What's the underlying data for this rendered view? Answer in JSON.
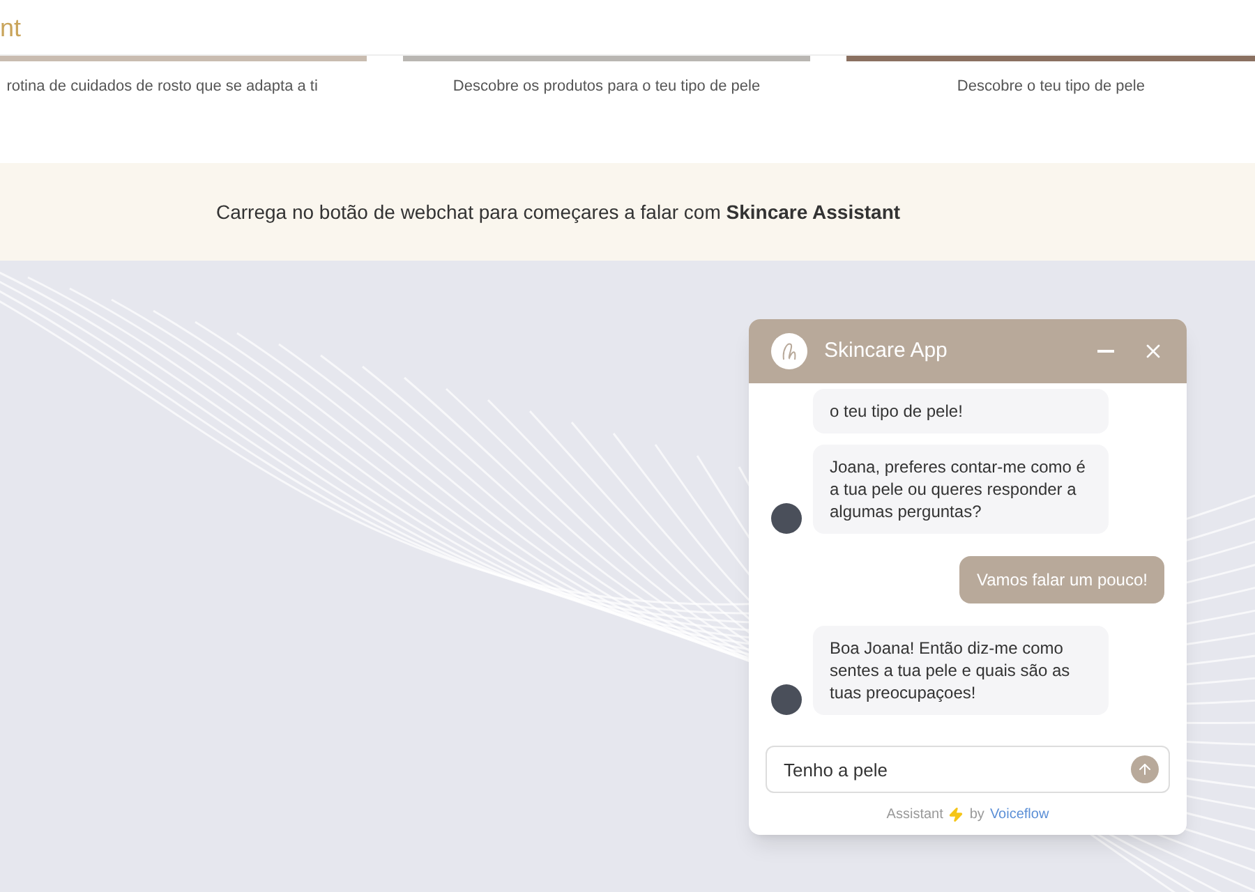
{
  "header": {
    "brand": "nt"
  },
  "cards": [
    {
      "caption": "rotina de cuidados de rosto que se adapta a ti"
    },
    {
      "caption": "Descobre os produtos para o teu tipo de pele"
    },
    {
      "caption": "Descobre o teu tipo de pele"
    }
  ],
  "banner": {
    "text": "Carrega no botão de webchat para começares a falar com **Skincare Assistant**"
  },
  "chat": {
    "title": "Skincare App",
    "messages": [
      {
        "kind": "bot",
        "text": "o teu tipo de pele!",
        "avatar": false
      },
      {
        "kind": "bot",
        "text": "Joana, preferes contar-me como é a tua pele ou queres responder a algumas perguntas?",
        "avatar": true
      },
      {
        "kind": "user",
        "text": "Vamos falar um pouco!"
      },
      {
        "kind": "bot",
        "text": "Boa Joana! Então diz-me como sentes a tua pele e quais são as tuas preocupaçoes!",
        "avatar": true
      }
    ],
    "input": {
      "value": "Tenho a pele"
    },
    "footer": {
      "text": "Assistant",
      "by": "by",
      "link": "Voiceflow"
    }
  }
}
